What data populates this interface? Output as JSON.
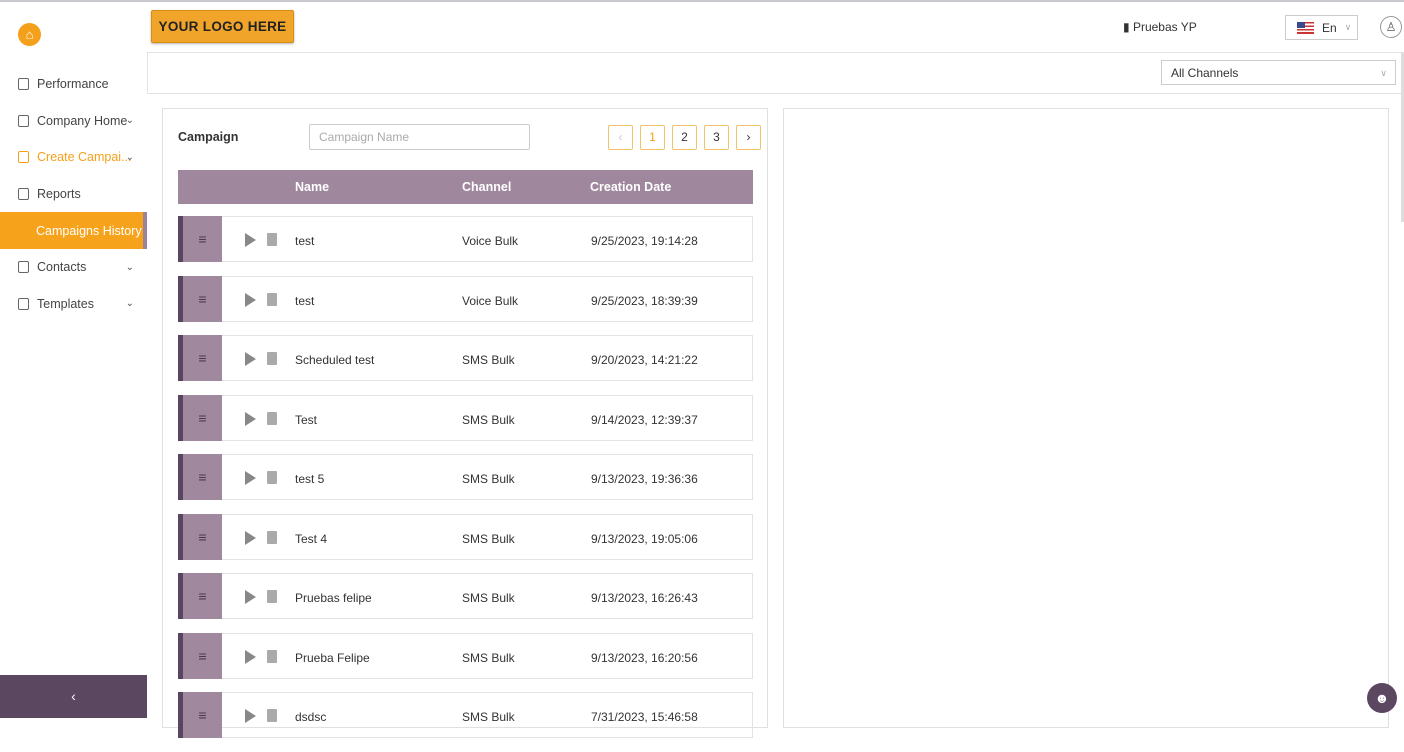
{
  "header": {
    "logo": "YOUR LOGO HERE",
    "company": "Pruebas YP",
    "language": "En"
  },
  "sidebar": {
    "items": [
      {
        "label": "Performance",
        "chevron": false
      },
      {
        "label": "Company Home",
        "chevron": true
      },
      {
        "label": "Create Campai...",
        "chevron": true
      },
      {
        "label": "Reports",
        "chevron": false
      },
      {
        "label": "Campaigns History",
        "chevron": false
      },
      {
        "label": "Contacts",
        "chevron": true
      },
      {
        "label": "Templates",
        "chevron": true
      }
    ]
  },
  "filter": {
    "channel": "All Channels"
  },
  "campaign": {
    "label": "Campaign",
    "search_placeholder": "Campaign Name",
    "search_value": "",
    "pages": [
      "1",
      "2",
      "3"
    ],
    "current_page": "1",
    "columns": [
      "Name",
      "Channel",
      "Creation Date"
    ],
    "rows": [
      [
        "test",
        "Voice Bulk",
        "9/25/2023, 19:14:28"
      ],
      [
        "test",
        "Voice Bulk",
        "9/25/2023, 18:39:39"
      ],
      [
        "Scheduled test",
        "SMS Bulk",
        "9/20/2023, 14:21:22"
      ],
      [
        "Test",
        "SMS Bulk",
        "9/14/2023, 12:39:37"
      ],
      [
        "test 5",
        "SMS Bulk",
        "9/13/2023, 19:36:36"
      ],
      [
        "Test 4",
        "SMS Bulk",
        "9/13/2023, 19:05:06"
      ],
      [
        "Pruebas felipe",
        "SMS Bulk",
        "9/13/2023, 16:26:43"
      ],
      [
        "Prueba Felipe",
        "SMS Bulk",
        "9/13/2023, 16:20:56"
      ],
      [
        "dsdsc",
        "SMS Bulk",
        "7/31/2023, 15:46:58"
      ]
    ]
  }
}
